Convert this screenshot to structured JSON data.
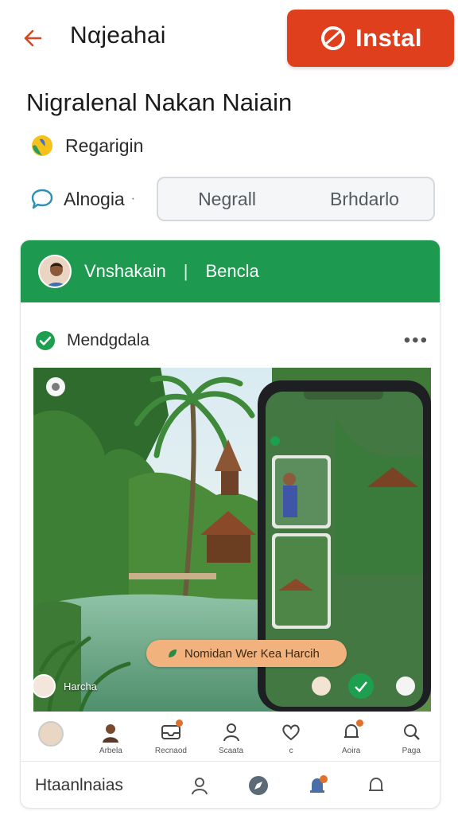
{
  "header": {
    "app_title": "Nαjeahai",
    "install_label": "Instal"
  },
  "headline": "Nigralenal Nakan Naiain",
  "region": {
    "label": "Regarigin"
  },
  "chat": {
    "label": "Alnogia",
    "dot": "·"
  },
  "tabs": [
    {
      "label": "Negrall"
    },
    {
      "label": "Brhdarlo"
    }
  ],
  "card": {
    "header_name": "Vnshakain",
    "header_sep": "|",
    "header_sub": "Bencla",
    "post_label": "Mendgdala",
    "more": "•••",
    "toast_text": "Nomidan Wer Kea Harcih",
    "scene_user": "Harcha"
  },
  "nav": [
    {
      "label": "",
      "icon": "avatar-icon"
    },
    {
      "label": "Arbela",
      "icon": "person-icon"
    },
    {
      "label": "Recnaod",
      "icon": "inbox-icon"
    },
    {
      "label": "Scaata",
      "icon": "people-icon"
    },
    {
      "label": "c",
      "icon": "heart-icon"
    },
    {
      "label": "Aoira",
      "icon": "bell-icon"
    },
    {
      "label": "Paga",
      "icon": "profile-icon"
    }
  ],
  "footer": {
    "label": "Htaanlnaias",
    "icons": [
      "person-outline-icon",
      "compass-icon",
      "bell-badge-icon",
      "bell-outline-icon"
    ]
  },
  "colors": {
    "install": "#df3f1c",
    "card_header": "#1d9a4f",
    "toast": "#f2b27d"
  }
}
